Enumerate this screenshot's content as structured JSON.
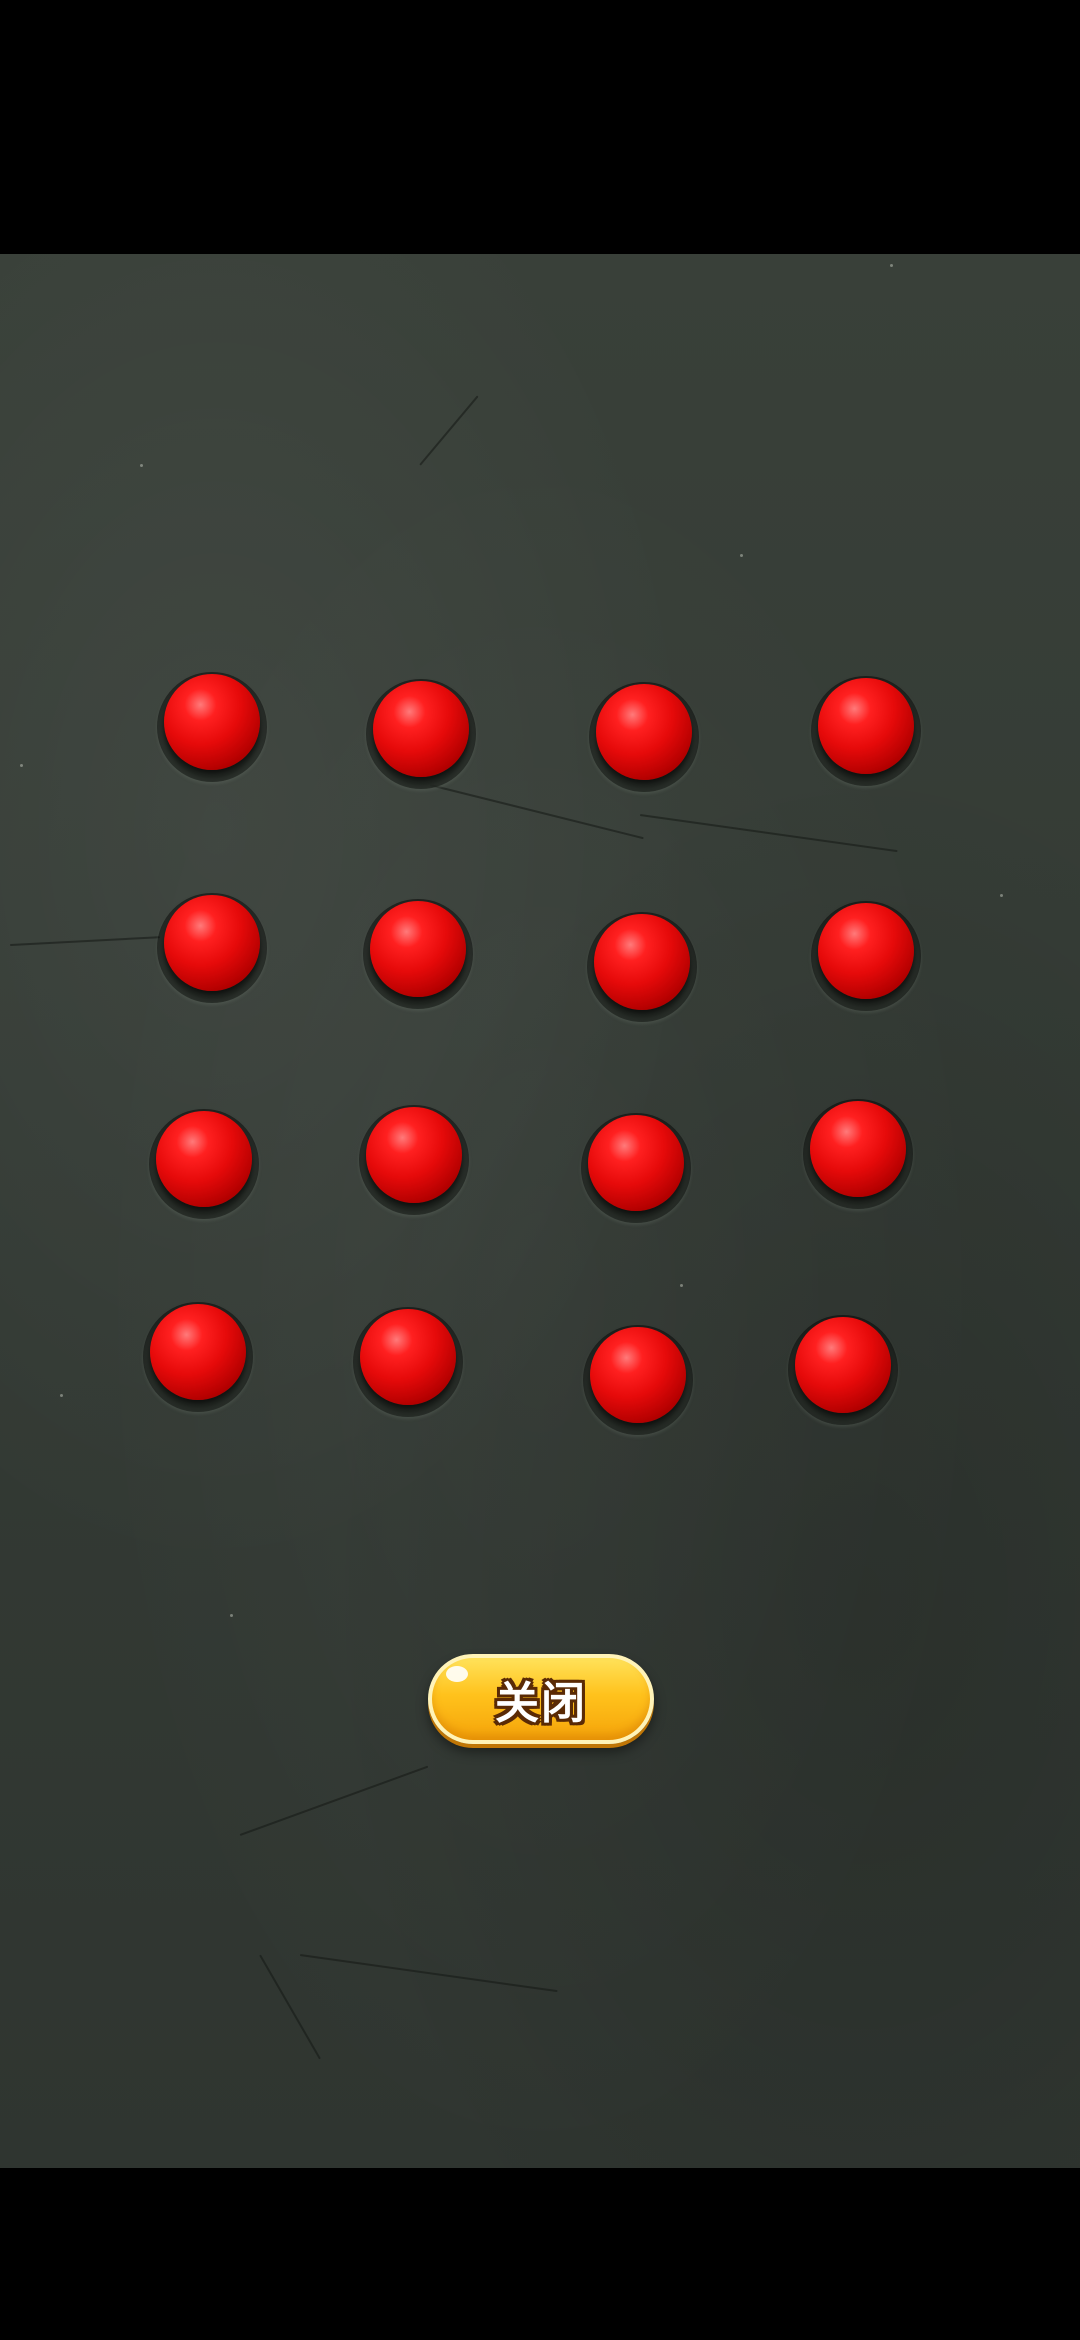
{
  "game": {
    "board": {
      "rows": 4,
      "columns": 4,
      "ball_count": 16,
      "ball_color": "#e60a0a",
      "surface_color": "#363d37"
    },
    "close_button": {
      "label": "关闭",
      "color": "#ffc21c"
    }
  }
}
